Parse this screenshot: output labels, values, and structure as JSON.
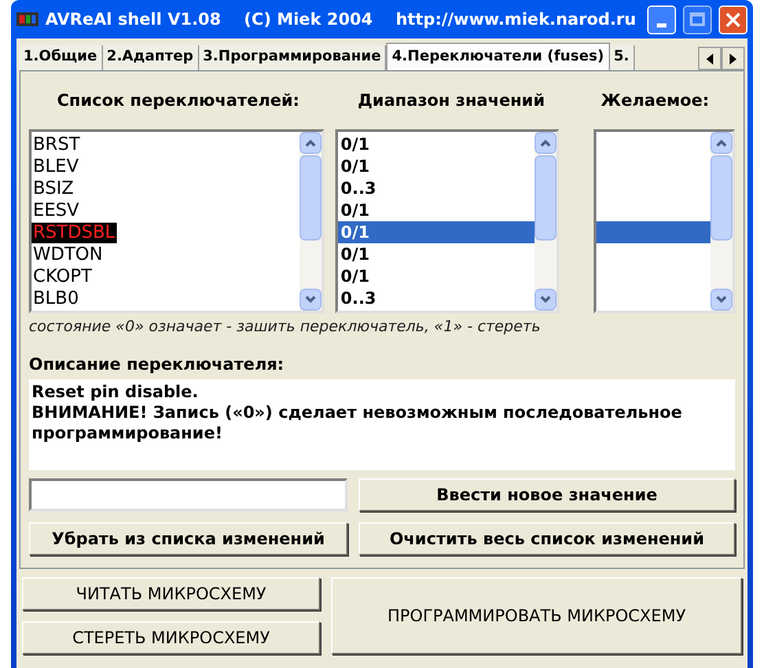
{
  "window": {
    "title": "AVReAl shell V1.08    (C) Miek 2004    http://www.miek.narod.ru"
  },
  "tabs": [
    {
      "label": "1.Общие",
      "selected": false
    },
    {
      "label": "2.Адаптер",
      "selected": false
    },
    {
      "label": "3.Программирование",
      "selected": false
    },
    {
      "label": "4.Переключатели (fuses)",
      "selected": true
    },
    {
      "label": "5.",
      "selected": false
    }
  ],
  "fuses": {
    "heading": "Список переключателей:",
    "items": [
      {
        "label": "BRST",
        "selected": false
      },
      {
        "label": "BLEV",
        "selected": false
      },
      {
        "label": "BSIZ",
        "selected": false
      },
      {
        "label": "EESV",
        "selected": false
      },
      {
        "label": "RSTDSBL",
        "selected": true
      },
      {
        "label": "WDTON",
        "selected": false
      },
      {
        "label": "CKOPT",
        "selected": false
      },
      {
        "label": "BLB0",
        "selected": false
      }
    ]
  },
  "ranges": {
    "heading": "Диапазон значений",
    "items": [
      {
        "label": "0/1",
        "selected": false
      },
      {
        "label": "0/1",
        "selected": false
      },
      {
        "label": "0..3",
        "selected": false
      },
      {
        "label": "0/1",
        "selected": false
      },
      {
        "label": "0/1",
        "selected": true
      },
      {
        "label": "0/1",
        "selected": false
      },
      {
        "label": "0/1",
        "selected": false
      },
      {
        "label": "0..3",
        "selected": false
      }
    ]
  },
  "desired": {
    "heading": "Желаемое:",
    "items": [
      {
        "selected": false
      },
      {
        "selected": false
      },
      {
        "selected": false
      },
      {
        "selected": false
      },
      {
        "selected": true
      },
      {
        "selected": false
      },
      {
        "selected": false
      },
      {
        "selected": false
      }
    ]
  },
  "note": "состояние «0» означает - зашить переключатель, «1» - стереть",
  "description": {
    "heading": "Описание переключателя:",
    "lines": [
      "Reset pin disable.",
      "ВНИМАНИЕ! Запись («0») сделает невозможным последовательное программирование!"
    ]
  },
  "buttons": {
    "enter": "Ввести новое значение",
    "remove": "Убрать из списка изменений",
    "clear": "Очистить весь список изменений",
    "read": "ЧИТАТЬ МИКРОСХЕМУ",
    "erase": "СТЕРЕТЬ МИКРОСХЕМУ",
    "program": "ПРОГРАММИРОВАТЬ МИКРОСХЕМУ"
  }
}
